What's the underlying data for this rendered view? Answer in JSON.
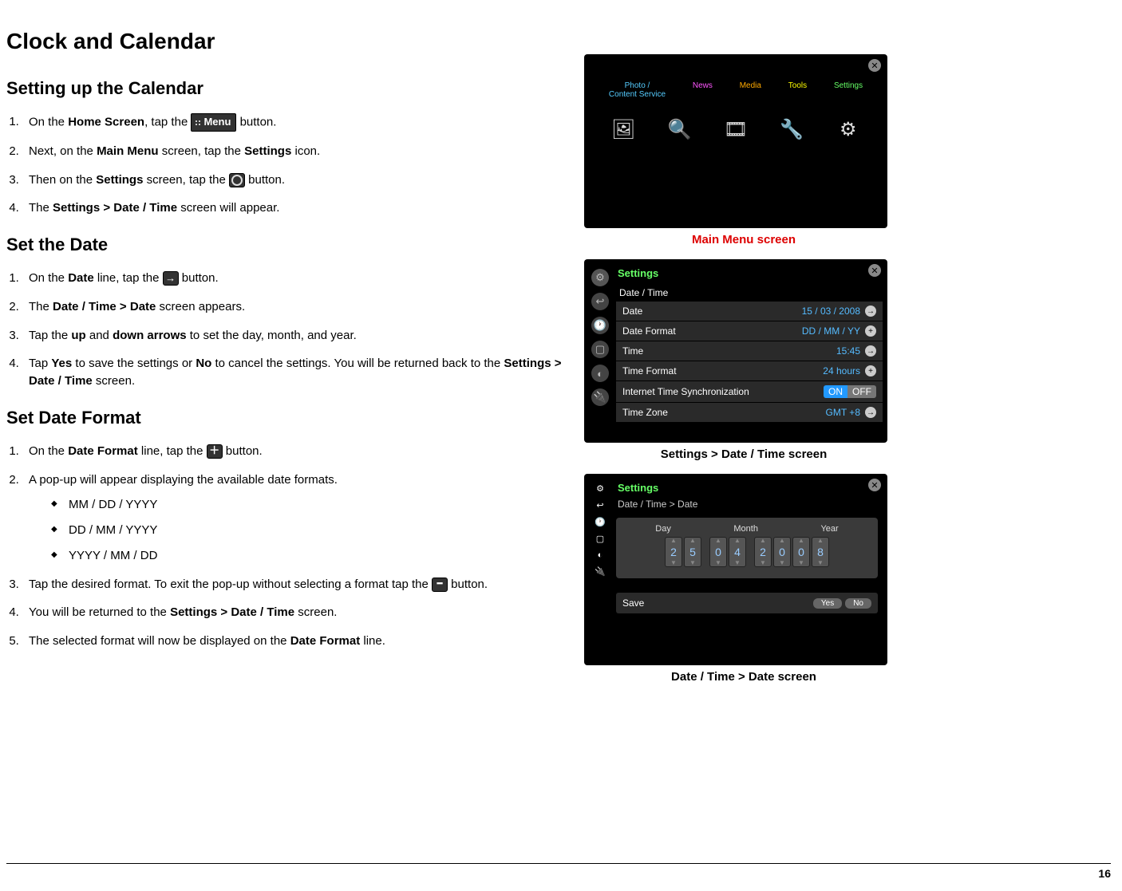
{
  "page": {
    "title": "Clock and Calendar",
    "number": "16"
  },
  "section1": {
    "heading": "Setting up the Calendar",
    "steps": {
      "s1_pre": "On the ",
      "s1_b1": "Home Screen",
      "s1_mid": ", tap the ",
      "s1_post": " button.",
      "menu_label": "Menu",
      "s2_pre": "Next, on the ",
      "s2_b1": "Main Menu",
      "s2_mid": " screen, tap the ",
      "s2_b2": "Settings",
      "s2_post": " icon.",
      "s3_pre": "Then on the ",
      "s3_b1": "Settings",
      "s3_mid": " screen, tap the ",
      "s3_post": " button.",
      "s4_pre": "The ",
      "s4_b1": "Settings > Date / Time",
      "s4_post": " screen will appear."
    }
  },
  "section2": {
    "heading": "Set the Date",
    "steps": {
      "s1_pre": "On the ",
      "s1_b1": "Date",
      "s1_mid": " line, tap the ",
      "s1_post": " button.",
      "s2_pre": "The ",
      "s2_b1": "Date / Time > Date",
      "s2_post": " screen appears.",
      "s3_pre": "Tap the ",
      "s3_b1": "up",
      "s3_mid1": " and ",
      "s3_b2": "down arrows",
      "s3_post": " to set the day, month, and year.",
      "s4_pre": "Tap ",
      "s4_b1": "Yes",
      "s4_mid1": " to save the settings or ",
      "s4_b2": "No",
      "s4_mid2": " to cancel the settings.  You will be returned back to the ",
      "s4_b3": "Settings > Date / Time",
      "s4_post": " screen."
    }
  },
  "section3": {
    "heading": "Set Date Format",
    "steps": {
      "s1_pre": "On the ",
      "s1_b1": "Date Format",
      "s1_mid": " line, tap the ",
      "s1_post": " button.",
      "s2": "A pop-up will appear displaying the available date formats.",
      "formats": [
        "MM / DD / YYYY",
        "DD / MM / YYYY",
        "YYYY / MM / DD"
      ],
      "s3_pre": "Tap the desired format.  To exit the pop-up without selecting a format tap the ",
      "s3_post": " button.",
      "s4_pre": "You will be returned to the ",
      "s4_b1": "Settings > Date / Time",
      "s4_post": " screen.",
      "s5_pre": "The selected format will now be displayed on the ",
      "s5_b1": "Date Format",
      "s5_post": " line."
    }
  },
  "figures": {
    "fig1": {
      "caption": "Main Menu screen",
      "tabs": {
        "photo_l1": "Photo /",
        "photo_l2": "Content Service",
        "news": "News",
        "media": "Media",
        "tools": "Tools",
        "settings": "Settings"
      }
    },
    "fig2": {
      "caption": "Settings > Date / Time screen",
      "title": "Settings",
      "section": "Date / Time",
      "rows": {
        "date_l": "Date",
        "date_v": "15 / 03 / 2008",
        "fmt_l": "Date Format",
        "fmt_v": "DD / MM / YY",
        "time_l": "Time",
        "time_v": "15:45",
        "tfmt_l": "Time Format",
        "tfmt_v": "24 hours",
        "sync_l": "Internet Time Synchronization",
        "sync_on": "ON",
        "sync_off": "OFF",
        "tz_l": "Time Zone",
        "tz_v": "GMT +8"
      }
    },
    "fig3": {
      "caption": "Date / Time > Date screen",
      "title": "Settings",
      "breadcrumb": "Date / Time > Date",
      "heads": {
        "day": "Day",
        "month": "Month",
        "year": "Year"
      },
      "digits": {
        "day": [
          "2",
          "5"
        ],
        "month": [
          "0",
          "4"
        ],
        "year": [
          "2",
          "0",
          "0",
          "8"
        ]
      },
      "save_label": "Save",
      "yes": "Yes",
      "no": "No"
    }
  }
}
